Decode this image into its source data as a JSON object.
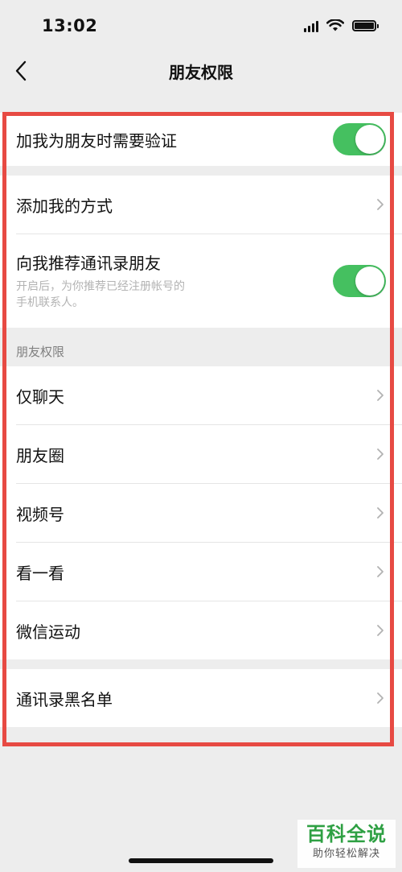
{
  "status_bar": {
    "time": "13:02"
  },
  "nav": {
    "title": "朋友权限"
  },
  "groups": {
    "verify": {
      "label": "加我为朋友时需要验证",
      "toggle_on": true
    },
    "add": {
      "add_methods": "添加我的方式",
      "recommend_label": "向我推荐通讯录朋友",
      "recommend_desc": "开启后，为你推荐已经注册帐号的\n手机联系人。",
      "recommend_toggle_on": true
    },
    "permissions": {
      "header": "朋友权限",
      "items": [
        "仅聊天",
        "朋友圈",
        "视频号",
        "看一看",
        "微信运动"
      ]
    },
    "blacklist": {
      "label": "通讯录黑名单"
    }
  },
  "colors": {
    "toggle_on": "#45c060",
    "highlight_frame": "#e74a43",
    "background": "#ededed"
  },
  "watermark": {
    "main": "百科全说",
    "sub": "助你轻松解决"
  }
}
